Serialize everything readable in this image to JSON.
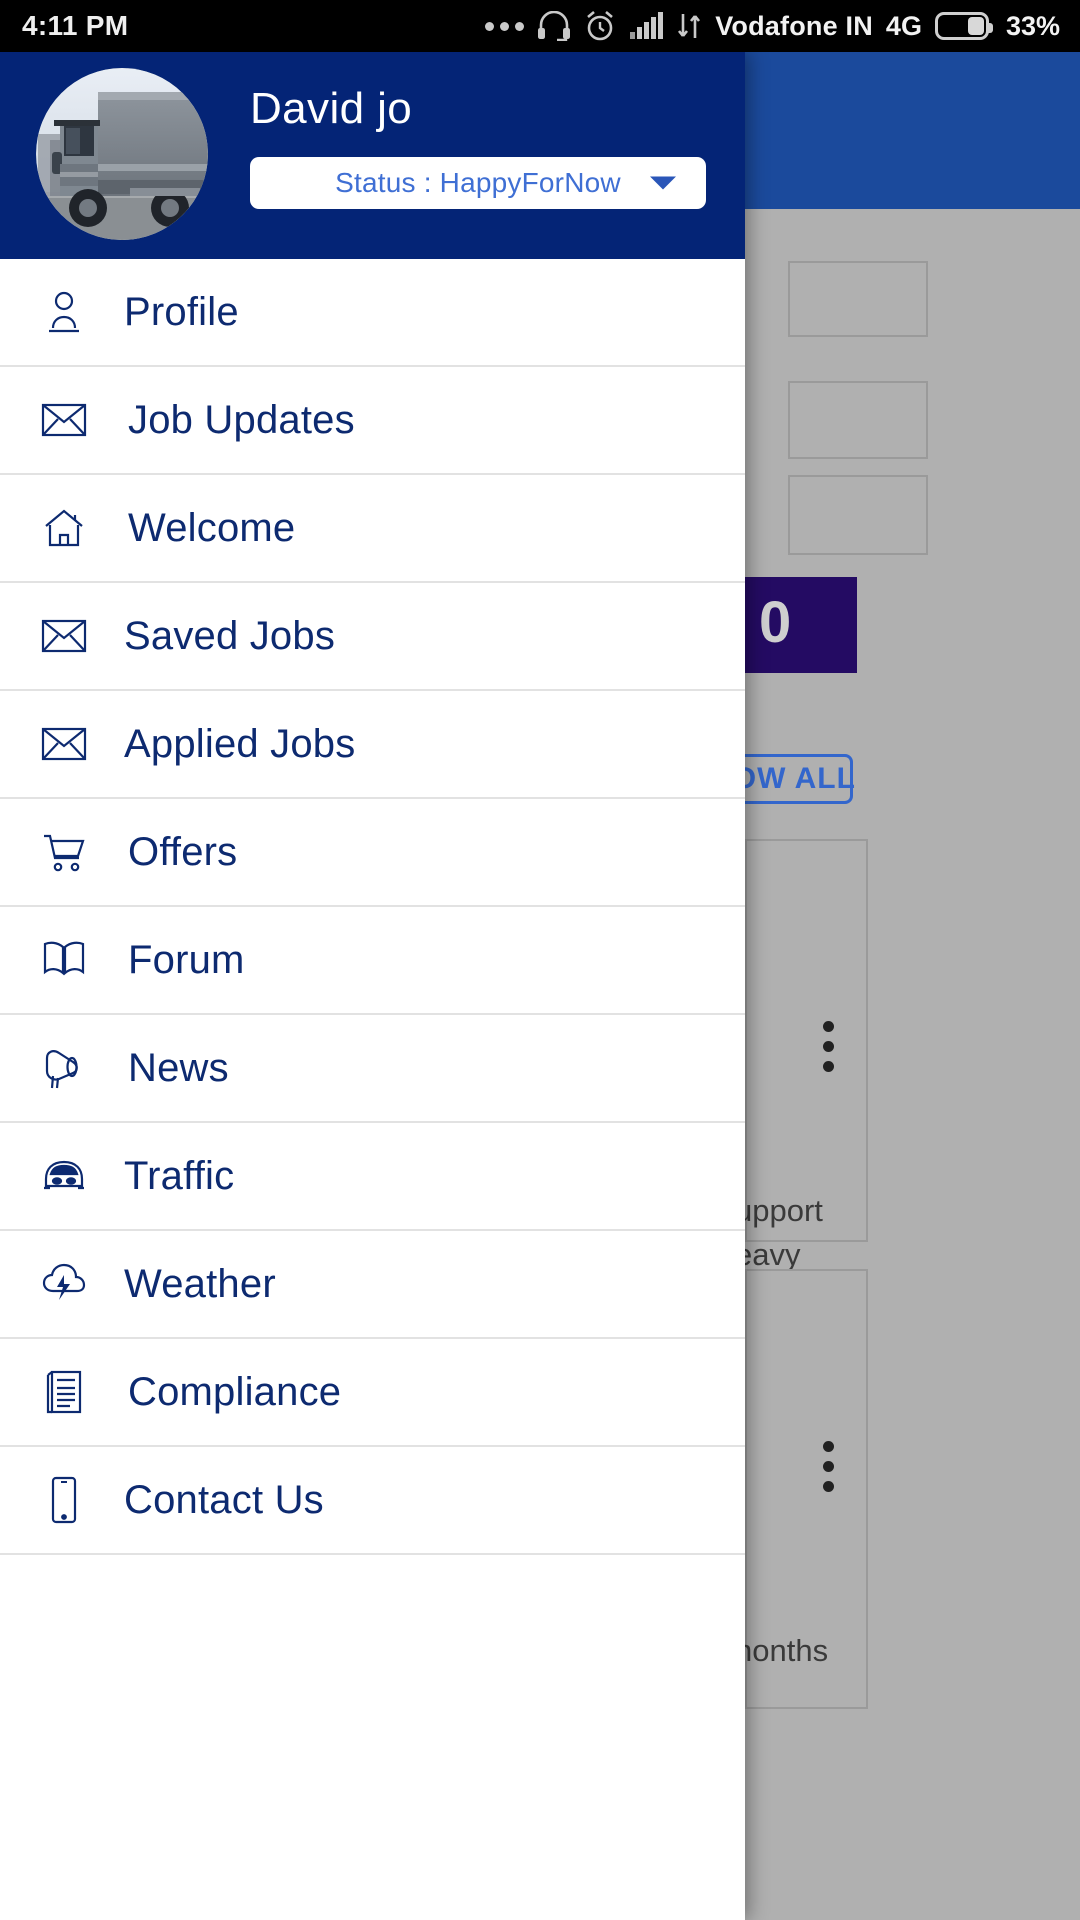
{
  "status_bar": {
    "time": "4:11 PM",
    "carrier": "Vodafone IN",
    "network": "4G",
    "battery_percent": "33%",
    "icons": [
      "more-dots-icon",
      "headset-icon",
      "alarm-clock-icon",
      "signal-bars-icon",
      "data-transfer-icon",
      "battery-icon"
    ]
  },
  "drawer": {
    "profile": {
      "name": "David jo",
      "avatar_alt": "truck-avatar",
      "status_label": "Status : HappyForNow",
      "status_dropdown_icon": "chevron-down-icon"
    },
    "menu": [
      {
        "label": "Profile",
        "icon": "person-icon"
      },
      {
        "label": "Job Updates",
        "icon": "envelope-icon"
      },
      {
        "label": "Welcome",
        "icon": "home-icon"
      },
      {
        "label": "Saved Jobs",
        "icon": "envelope-icon"
      },
      {
        "label": "Applied Jobs",
        "icon": "envelope-icon"
      },
      {
        "label": "Offers",
        "icon": "shopping-cart-icon"
      },
      {
        "label": "Forum",
        "icon": "open-book-icon"
      },
      {
        "label": "News",
        "icon": "megaphone-icon"
      },
      {
        "label": "Traffic",
        "icon": "car-icon"
      },
      {
        "label": "Weather",
        "icon": "cloud-lightning-icon"
      },
      {
        "label": "Compliance",
        "icon": "document-list-icon"
      },
      {
        "label": "Contact Us",
        "icon": "mobile-phone-icon"
      }
    ]
  },
  "background": {
    "counter_badge": "0",
    "show_all_button": "HOW ALL",
    "card_text_1": "upport",
    "card_text_2": "eavy",
    "card_text_3": "nonths",
    "overflow_icon": "kebab-menu-icon"
  },
  "colors": {
    "header_blue": "#042476",
    "menu_text_blue": "#0d2a70",
    "status_text_blue": "#3f6fd4",
    "appbar_blue": "#1b4a9c",
    "badge_purple": "#240b63",
    "accent_link": "#3366cc"
  }
}
